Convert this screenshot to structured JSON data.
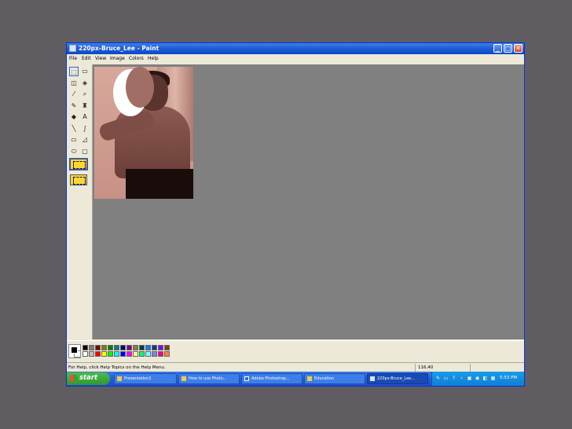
{
  "window": {
    "title": "220px-Bruce_Lee - Paint",
    "controls": {
      "minimize": "_",
      "maximize": "□",
      "close": "✕"
    }
  },
  "menu": [
    "File",
    "Edit",
    "View",
    "Image",
    "Colors",
    "Help"
  ],
  "tools": [
    {
      "name": "free-select-icon",
      "glyph": "⬚"
    },
    {
      "name": "rect-select-icon",
      "glyph": "▭"
    },
    {
      "name": "eraser-icon",
      "glyph": "◫"
    },
    {
      "name": "fill-icon",
      "glyph": "◈"
    },
    {
      "name": "color-picker-icon",
      "glyph": "⁄"
    },
    {
      "name": "magnifier-icon",
      "glyph": "⌕"
    },
    {
      "name": "pencil-icon",
      "glyph": "✎"
    },
    {
      "name": "brush-icon",
      "glyph": "♜"
    },
    {
      "name": "airbrush-icon",
      "glyph": "◆"
    },
    {
      "name": "text-icon",
      "glyph": "A"
    },
    {
      "name": "line-icon",
      "glyph": "╲"
    },
    {
      "name": "curve-icon",
      "glyph": "∫"
    },
    {
      "name": "rectangle-icon",
      "glyph": "▭"
    },
    {
      "name": "polygon-icon",
      "glyph": "◿"
    },
    {
      "name": "ellipse-icon",
      "glyph": "⬭"
    },
    {
      "name": "rounded-rect-icon",
      "glyph": "▢"
    }
  ],
  "palette": {
    "foreground": "#000000",
    "background": "#ffffff",
    "row1": [
      "#000000",
      "#808080",
      "#800000",
      "#808000",
      "#008000",
      "#008080",
      "#000080",
      "#800080",
      "#808040",
      "#004040",
      "#0080ff",
      "#004080",
      "#8000ff",
      "#804000"
    ],
    "row2": [
      "#ffffff",
      "#c0c0c0",
      "#ff0000",
      "#ffff00",
      "#00ff00",
      "#00ffff",
      "#0000ff",
      "#ff00ff",
      "#ffff80",
      "#00ff80",
      "#80ffff",
      "#8080ff",
      "#ff0080",
      "#ff8040"
    ]
  },
  "status": {
    "help": "For Help, click Help Topics on the Help Menu.",
    "coords": "116,40"
  },
  "taskbar": {
    "start": "start",
    "tasks": [
      "Presentation1",
      "How to use Photo...",
      "Adobe Photoshop...",
      "Education",
      "220px-Bruce_Lee..."
    ],
    "clock": "5:53 PM"
  }
}
